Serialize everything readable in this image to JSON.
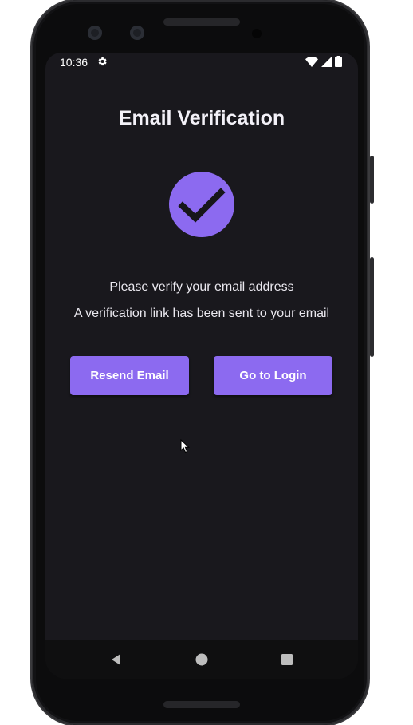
{
  "status_bar": {
    "time": "10:36",
    "icons": [
      "gear-icon",
      "wifi-icon",
      "signal-icon",
      "battery-icon"
    ]
  },
  "page": {
    "title": "Email Verification",
    "icon": "check-circle-icon",
    "message_primary": "Please verify your email address",
    "message_secondary": "A verification link has been sent to your email"
  },
  "buttons": {
    "resend_label": "Resend Email",
    "login_label": "Go to Login"
  },
  "nav_bar": {
    "icons": [
      "back-icon",
      "home-icon",
      "recents-icon"
    ]
  },
  "colors": {
    "background": "#19181d",
    "accent": "#8c6af0",
    "text": "#eae8ef"
  }
}
